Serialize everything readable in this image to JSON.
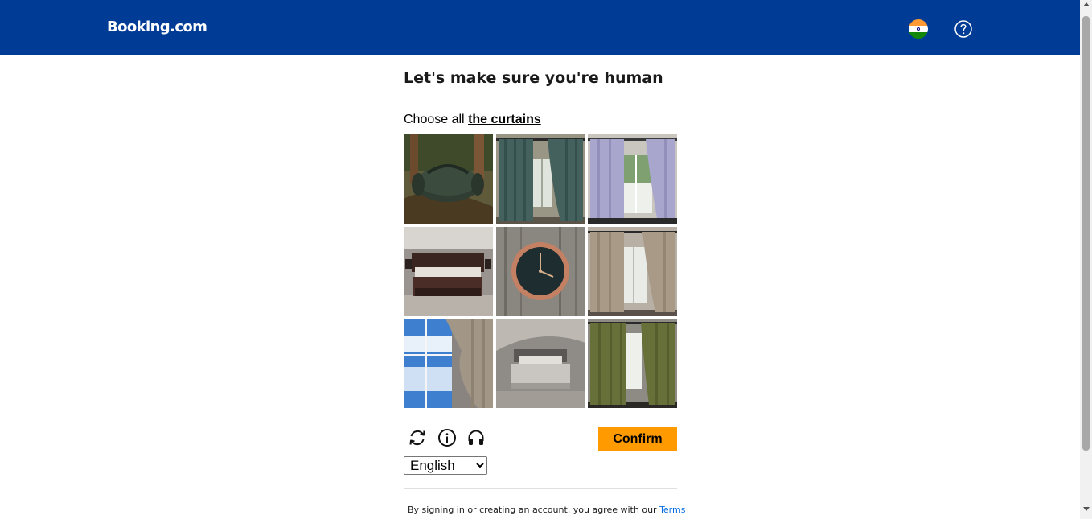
{
  "header": {
    "logo": "Booking.com",
    "flag_icon": "india-flag-icon",
    "help_icon": "help-circle-icon",
    "background": "#003b95"
  },
  "captcha": {
    "title": "Let's make sure you're human",
    "instruction_prefix": "Choose all",
    "instruction_target": "the curtains",
    "tiles": [
      {
        "content": "duffel bag in forest"
      },
      {
        "content": "dark teal curtains"
      },
      {
        "content": "lavender curtains"
      },
      {
        "content": "bed in bedroom"
      },
      {
        "content": "wall clock on wood"
      },
      {
        "content": "beige curtains"
      },
      {
        "content": "curtain by sky window"
      },
      {
        "content": "bed with grey sheets"
      },
      {
        "content": "olive green curtains"
      }
    ],
    "controls": {
      "refresh_icon": "refresh-icon",
      "info_icon": "info-icon",
      "audio_icon": "headphones-icon"
    },
    "confirm_label": "Confirm",
    "confirm_color": "#ff9a00",
    "language": "English",
    "language_options": [
      "English"
    ]
  },
  "footer": {
    "terms_text": "By signing in or creating an account, you agree with our",
    "terms_link": "Terms",
    "link_color": "#006ce4"
  }
}
